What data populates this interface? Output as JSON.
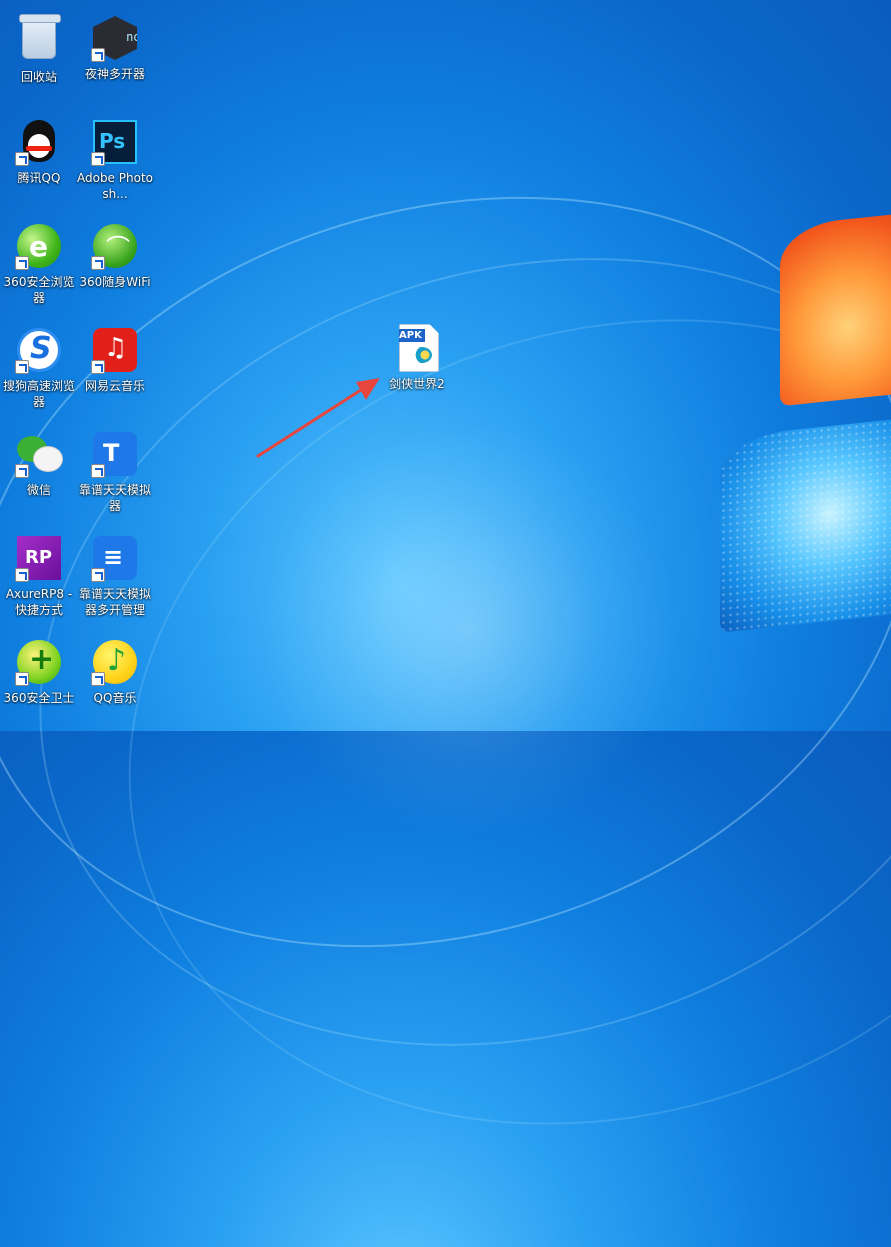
{
  "desktop": {
    "icons": [
      {
        "label": "回收站",
        "icon": "recycle-bin-icon",
        "shortcut": false
      },
      {
        "label": "夜神多开器",
        "icon": "nox-icon",
        "shortcut": true,
        "glyph": "nox"
      },
      {
        "label": "腾讯QQ",
        "icon": "qq-icon",
        "shortcut": true
      },
      {
        "label": "Adobe Photosh...",
        "icon": "photoshop-icon",
        "shortcut": true,
        "glyph": "Ps"
      },
      {
        "label": "360安全浏览器",
        "icon": "360-browser-icon",
        "shortcut": true,
        "glyph": "e"
      },
      {
        "label": "360随身WiFi",
        "icon": "360-wifi-icon",
        "shortcut": true
      },
      {
        "label": "搜狗高速浏览器",
        "icon": "sogou-browser-icon",
        "shortcut": true,
        "glyph": "S"
      },
      {
        "label": "网易云音乐",
        "icon": "netease-music-icon",
        "shortcut": true,
        "glyph": "♫"
      },
      {
        "label": "微信",
        "icon": "wechat-icon",
        "shortcut": true
      },
      {
        "label": "靠谱天天模拟器",
        "icon": "tiantian-emulator-icon",
        "shortcut": true,
        "glyph": "T"
      },
      {
        "label": "AxureRP8 - 快捷方式",
        "icon": "axure-rp-icon",
        "shortcut": true,
        "glyph": "RP"
      },
      {
        "label": "靠谱天天模拟器多开管理",
        "icon": "tiantian-multi-icon",
        "shortcut": true,
        "glyph": "≡"
      },
      {
        "label": "360安全卫士",
        "icon": "360-security-icon",
        "shortcut": true,
        "glyph": "+"
      },
      {
        "label": "QQ音乐",
        "icon": "qq-music-icon",
        "shortcut": true,
        "glyph": "♪"
      },
      {
        "label": "剑侠世界2",
        "icon": "apk-file-icon",
        "shortcut": false,
        "glyph": "APK"
      }
    ]
  },
  "colors": {
    "arrow": "#e8453c"
  }
}
